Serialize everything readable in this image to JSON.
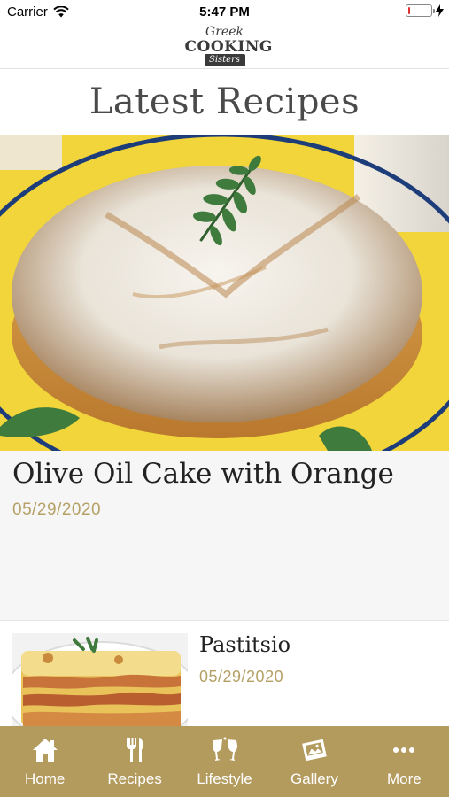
{
  "status_bar": {
    "carrier": "Carrier",
    "time": "5:47 PM",
    "battery_level": 0.1
  },
  "header": {
    "logo_text": {
      "line1": "Greek",
      "line2": "COOKING",
      "line3": "Sisters"
    }
  },
  "page": {
    "title": "Latest Recipes"
  },
  "featured": {
    "title": "Olive Oil Cake with Orange",
    "date": "05/29/2020"
  },
  "list": [
    {
      "title": "Pastitsio",
      "date": "05/29/2020"
    }
  ],
  "tabs": [
    {
      "label": "Home",
      "icon": "home-icon"
    },
    {
      "label": "Recipes",
      "icon": "fork-knife-icon"
    },
    {
      "label": "Lifestyle",
      "icon": "wine-glasses-icon"
    },
    {
      "label": "Gallery",
      "icon": "photos-icon"
    },
    {
      "label": "More",
      "icon": "more-dots-icon"
    }
  ],
  "colors": {
    "accent": "#b39a5d",
    "date": "#b5a065",
    "battery_low": "#e0302e"
  }
}
